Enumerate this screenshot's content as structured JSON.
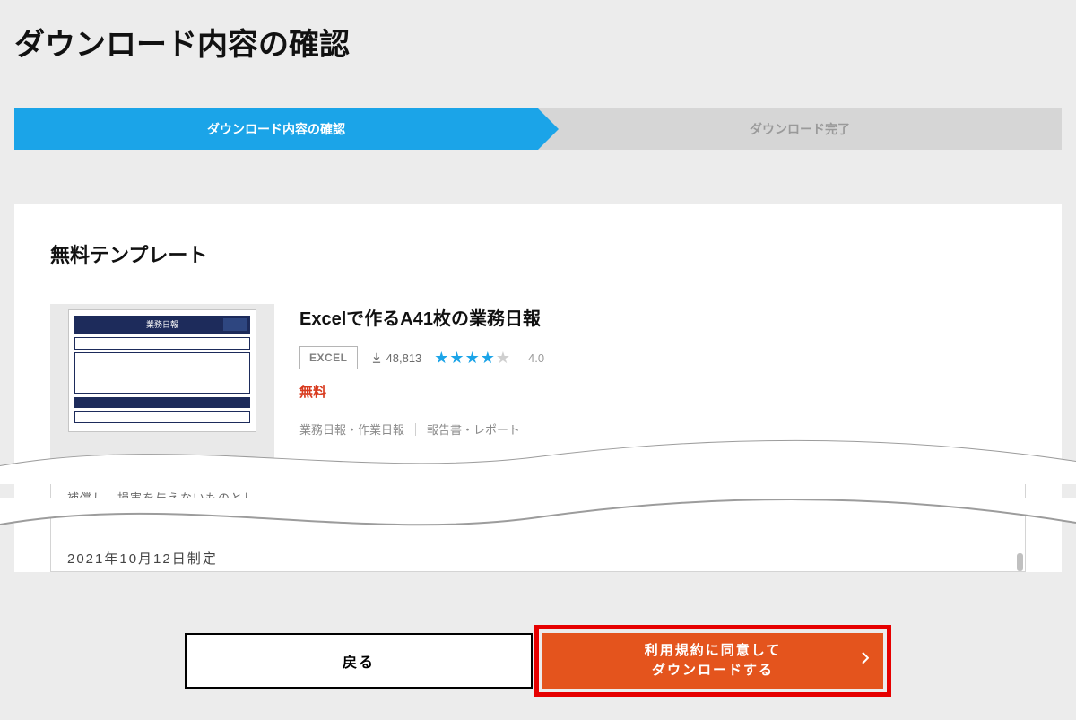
{
  "page": {
    "title": "ダウンロード内容の確認"
  },
  "steps": {
    "active": "ダウンロード内容の確認",
    "inactive": "ダウンロード完了"
  },
  "section": {
    "heading": "無料テンプレート"
  },
  "item": {
    "title": "Excelで作るA41枚の業務日報",
    "format_badge": "EXCEL",
    "download_count": "48,813",
    "rating_value": "4.0",
    "rating_filled": 4,
    "price_label": "無料",
    "tag1": "業務日報・作業日報",
    "tag2": "報告書・レポート",
    "thumb": {
      "header": "業務日報"
    }
  },
  "terms": {
    "fragment": "補償し、損害を与えないものとし…",
    "established": "2021年10月12日制定"
  },
  "actions": {
    "back": "戻る",
    "agree_line1": "利用規約に同意して",
    "agree_line2": "ダウンロードする"
  }
}
